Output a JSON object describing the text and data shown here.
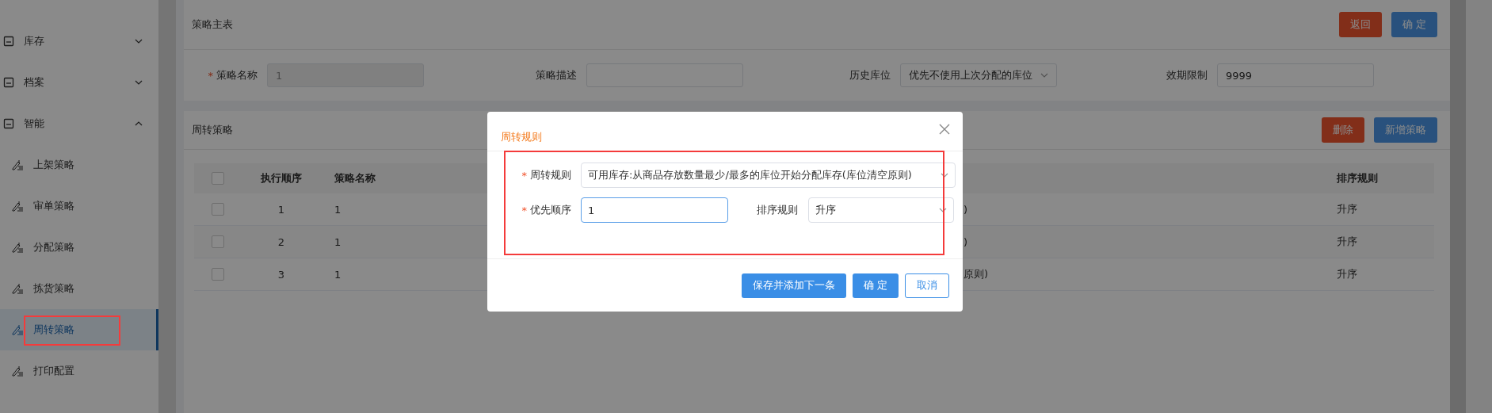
{
  "sidebar": {
    "items": [
      {
        "label": "库存",
        "expanded": false
      },
      {
        "label": "档案",
        "expanded": false
      },
      {
        "label": "智能",
        "expanded": true,
        "children": [
          {
            "label": "上架策略",
            "selected": false
          },
          {
            "label": "审单策略",
            "selected": false
          },
          {
            "label": "分配策略",
            "selected": false
          },
          {
            "label": "拣货策略",
            "selected": false
          },
          {
            "label": "周转策略",
            "selected": true
          },
          {
            "label": "打印配置",
            "selected": false
          }
        ]
      }
    ]
  },
  "main_card": {
    "title": "策略主表",
    "buttons": [
      {
        "label": "返回",
        "kind": "danger"
      },
      {
        "label": "确 定",
        "kind": "primary"
      }
    ],
    "fields": [
      {
        "label": "策略名称",
        "required_mark": "*",
        "kind": "input",
        "value": "1",
        "disabled": true
      },
      {
        "label": "策略描述",
        "kind": "input"
      },
      {
        "label": "历史库位",
        "kind": "select",
        "value": "优先不使用上次分配的库位"
      },
      {
        "label": "效期限制",
        "kind": "input",
        "value": "9999"
      }
    ]
  },
  "table_card": {
    "title": "周转策略",
    "buttons": [
      {
        "label": "删除",
        "kind": "danger"
      },
      {
        "label": "新增策略",
        "kind": "primary"
      }
    ],
    "select_all_checked": false,
    "columns": {
      "order": "执行顺序",
      "name": "策略名称",
      "sort_rule": "排序规则"
    },
    "rows": [
      {
        "checked": false,
        "order": "1",
        "name": "1",
        "column_4": ")",
        "sort_rule": "升序"
      },
      {
        "checked": false,
        "order": "2",
        "name": "1",
        "column_4": ")",
        "sort_rule": "升序"
      },
      {
        "checked": false,
        "order": "3",
        "name": "1",
        "column_4": "原则)",
        "sort_rule": "升序"
      }
    ]
  },
  "dialog": {
    "title": "周转规则",
    "fields": [
      {
        "label": "周转规则",
        "required_mark": "*",
        "kind": "select",
        "value": "可用库存:从商品存放数量最少/最多的库位开始分配库存(库位清空原则)",
        "focused": false
      },
      {
        "label": "优先顺序",
        "required_mark": "*",
        "kind": "input",
        "value": "1",
        "focused": true
      },
      {
        "label": "排序规则",
        "kind": "select",
        "value": "升序",
        "focused": false
      }
    ],
    "buttons": [
      {
        "label": "保存并添加下一条",
        "kind": "primary"
      },
      {
        "label": "确 定",
        "kind": "primary"
      },
      {
        "label": "取消",
        "kind": "plain"
      }
    ]
  }
}
